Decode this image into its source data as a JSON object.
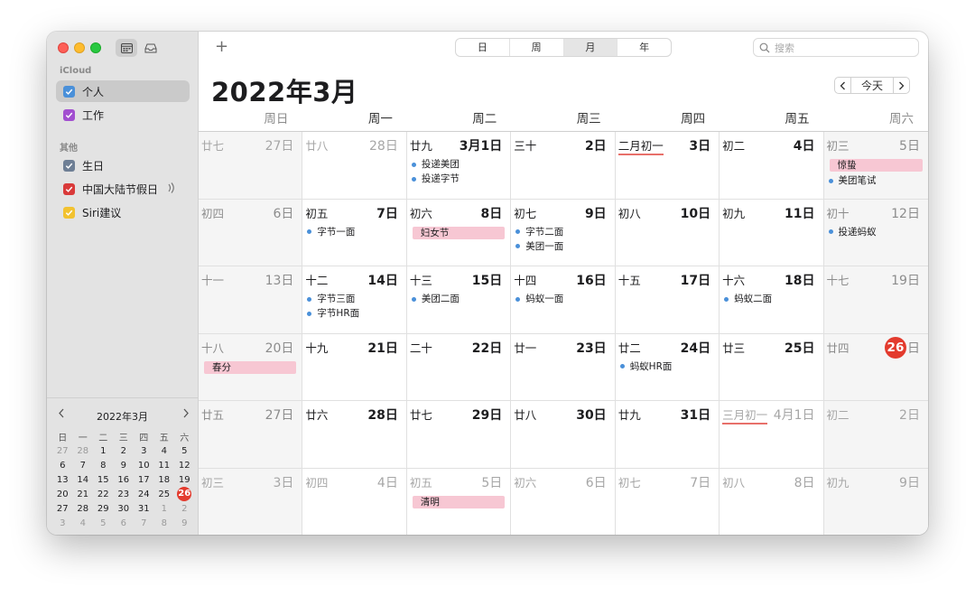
{
  "toolbar": {
    "add": "+",
    "views": [
      "日",
      "周",
      "月",
      "年"
    ],
    "active_view_index": 2,
    "search_placeholder": "搜索"
  },
  "header": {
    "title": "2022年3月",
    "today_button": "今天",
    "prev": "‹",
    "next": "›"
  },
  "sidebar": {
    "icloud_label": "iCloud",
    "other_label": "其他",
    "icloud_calendars": [
      {
        "label": "个人",
        "color": "#4a90d9",
        "selected": true
      },
      {
        "label": "工作",
        "color": "#a24fd0",
        "selected": false
      }
    ],
    "other_calendars": [
      {
        "label": "生日",
        "color": "#6e7f95"
      },
      {
        "label": "中国大陆节假日",
        "color": "#d93a3a",
        "broadcast": true
      },
      {
        "label": "Siri建议",
        "color": "#f2c230"
      }
    ]
  },
  "mini_calendar": {
    "title": "2022年3月",
    "weekdays": [
      "日",
      "一",
      "二",
      "三",
      "四",
      "五",
      "六"
    ],
    "weeks": [
      [
        "27",
        "28",
        "1",
        "2",
        "3",
        "4",
        "5"
      ],
      [
        "6",
        "7",
        "8",
        "9",
        "10",
        "11",
        "12"
      ],
      [
        "13",
        "14",
        "15",
        "16",
        "17",
        "18",
        "19"
      ],
      [
        "20",
        "21",
        "22",
        "23",
        "24",
        "25",
        "26"
      ],
      [
        "27",
        "28",
        "29",
        "30",
        "31",
        "1",
        "2"
      ],
      [
        "3",
        "4",
        "5",
        "6",
        "7",
        "8",
        "9"
      ]
    ],
    "today": "26"
  },
  "weekday_headers": [
    "周日",
    "周一",
    "周二",
    "周三",
    "周四",
    "周五",
    "周六"
  ],
  "weeks": [
    [
      {
        "lunar": "廿七",
        "solar": "27日",
        "dim": true
      },
      {
        "lunar": "廿八",
        "solar": "28日",
        "dim": true
      },
      {
        "lunar": "廿九",
        "solar": "3月1日",
        "events": [
          "投递美团",
          "投递字节"
        ]
      },
      {
        "lunar": "三十",
        "solar": "2日"
      },
      {
        "lunar": "二月初一",
        "solar": "3日",
        "monthstart": true
      },
      {
        "lunar": "初二",
        "solar": "4日"
      },
      {
        "lunar": "初三",
        "solar": "5日",
        "holiday": "惊蛰",
        "events": [
          "美团笔试"
        ]
      }
    ],
    [
      {
        "lunar": "初四",
        "solar": "6日"
      },
      {
        "lunar": "初五",
        "solar": "7日",
        "events": [
          "字节一面"
        ]
      },
      {
        "lunar": "初六",
        "solar": "8日",
        "holiday": "妇女节"
      },
      {
        "lunar": "初七",
        "solar": "9日",
        "events": [
          "字节二面",
          "美团一面"
        ]
      },
      {
        "lunar": "初八",
        "solar": "10日"
      },
      {
        "lunar": "初九",
        "solar": "11日"
      },
      {
        "lunar": "初十",
        "solar": "12日",
        "events": [
          "投递蚂蚁"
        ]
      }
    ],
    [
      {
        "lunar": "十一",
        "solar": "13日"
      },
      {
        "lunar": "十二",
        "solar": "14日",
        "events": [
          "字节三面",
          "字节HR面"
        ]
      },
      {
        "lunar": "十三",
        "solar": "15日",
        "events": [
          "美团二面"
        ]
      },
      {
        "lunar": "十四",
        "solar": "16日",
        "events": [
          "蚂蚁一面"
        ]
      },
      {
        "lunar": "十五",
        "solar": "17日"
      },
      {
        "lunar": "十六",
        "solar": "18日",
        "events": [
          "蚂蚁二面"
        ]
      },
      {
        "lunar": "十七",
        "solar": "19日"
      }
    ],
    [
      {
        "lunar": "十八",
        "solar": "20日",
        "holiday": "春分"
      },
      {
        "lunar": "十九",
        "solar": "21日"
      },
      {
        "lunar": "二十",
        "solar": "22日"
      },
      {
        "lunar": "廿一",
        "solar": "23日"
      },
      {
        "lunar": "廿二",
        "solar": "24日",
        "events": [
          "蚂蚁HR面"
        ]
      },
      {
        "lunar": "廿三",
        "solar": "25日"
      },
      {
        "lunar": "廿四",
        "solar": "日",
        "today_num": "26",
        "today": true
      }
    ],
    [
      {
        "lunar": "廿五",
        "solar": "27日"
      },
      {
        "lunar": "廿六",
        "solar": "28日"
      },
      {
        "lunar": "廿七",
        "solar": "29日"
      },
      {
        "lunar": "廿八",
        "solar": "30日"
      },
      {
        "lunar": "廿九",
        "solar": "31日"
      },
      {
        "lunar": "三月初一",
        "solar": "4月1日",
        "dim": true,
        "monthstart": true
      },
      {
        "lunar": "初二",
        "solar": "2日",
        "dim": true
      }
    ],
    [
      {
        "lunar": "初三",
        "solar": "3日",
        "dim": true
      },
      {
        "lunar": "初四",
        "solar": "4日",
        "dim": true
      },
      {
        "lunar": "初五",
        "solar": "5日",
        "dim": true,
        "holiday": "清明"
      },
      {
        "lunar": "初六",
        "solar": "6日",
        "dim": true
      },
      {
        "lunar": "初七",
        "solar": "7日",
        "dim": true
      },
      {
        "lunar": "初八",
        "solar": "8日",
        "dim": true
      },
      {
        "lunar": "初九",
        "solar": "9日",
        "dim": true
      }
    ]
  ]
}
